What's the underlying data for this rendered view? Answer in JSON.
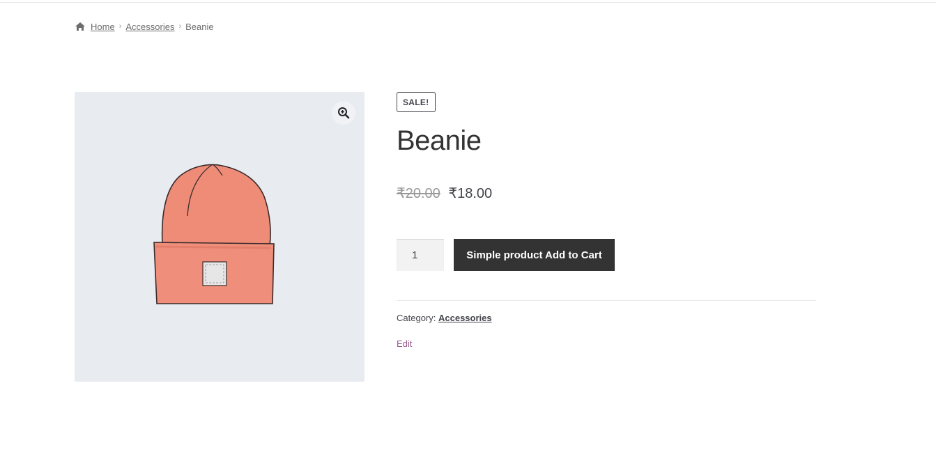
{
  "breadcrumb": {
    "home": "Home",
    "category": "Accessories",
    "current": "Beanie",
    "icon": "home-icon"
  },
  "gallery": {
    "zoom_icon": "zoom-in-icon",
    "image": "beanie-image"
  },
  "product": {
    "sale_badge": "SALE!",
    "title": "Beanie",
    "regular_price": "₹20.00",
    "sale_price": "₹18.00",
    "quantity": "1",
    "add_to_cart_label": "Simple product Add to Cart",
    "category_label": "Category:",
    "category_value": "Accessories",
    "edit_label": "Edit"
  },
  "colors": {
    "button_bg": "#333333",
    "link_purple": "#96588a",
    "gallery_bg": "#e8ecf0",
    "beanie": "#ee8c78"
  }
}
